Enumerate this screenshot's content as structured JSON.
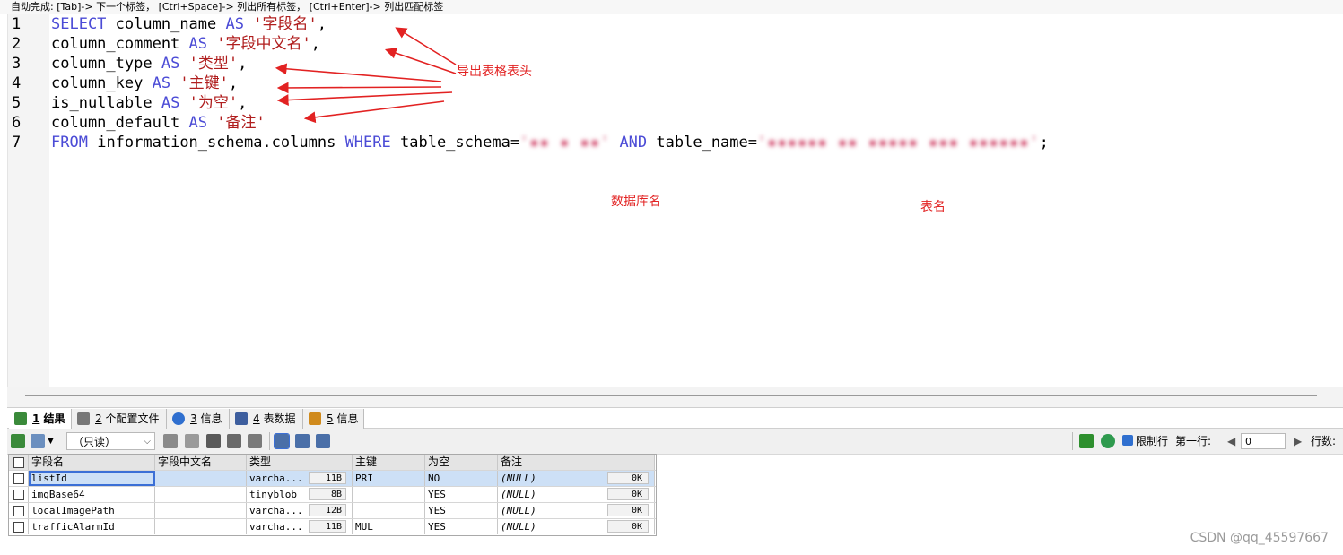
{
  "hint": "自动完成: [Tab]-> 下一个标签， [Ctrl+Space]-> 列出所有标签， [Ctrl+Enter]-> 列出匹配标签",
  "editor": {
    "line_numbers": [
      "1",
      "2",
      "3",
      "4",
      "5",
      "6",
      "7"
    ],
    "lines": [
      {
        "col": "column_name",
        "alias": "'字段名'",
        "end": ","
      },
      {
        "col": "column_comment",
        "alias": "'字段中文名'",
        "end": ","
      },
      {
        "col": "column_type",
        "alias": "'类型'",
        "end": ","
      },
      {
        "col": "column_key",
        "alias": "'主键'",
        "end": ","
      },
      {
        "col": "is_nullable",
        "alias": "'为空'",
        "end": ","
      },
      {
        "col": "column_default",
        "alias": "'备注'",
        "end": ""
      }
    ],
    "kw_select": "SELECT",
    "kw_as": "AS",
    "kw_from": "FROM",
    "kw_where": "WHERE",
    "kw_and": "AND",
    "from_table": "information_schema.columns",
    "schema_expr": "table_schema=",
    "schema_value_blurred": "'▪▪ ▪ ▪▪'",
    "name_expr": "table_name=",
    "name_value_blurred": "'▪▪▪▪▪▪ ▪▪ ▪▪▪▪▪ ▪▪▪ ▪▪▪▪▪▪'",
    "end": ";"
  },
  "annotations": {
    "export_header": "导出表格表头",
    "database_name": "数据库名",
    "table_name": "表名",
    "color": "#e22222"
  },
  "tabs": [
    {
      "num": "1",
      "label": "结果",
      "active": true,
      "icon_color": "#3a8a3a"
    },
    {
      "num": "2",
      "label": "个配置文件",
      "active": false,
      "icon_color": "#777777"
    },
    {
      "num": "3",
      "label": "信息",
      "active": false,
      "icon_color": "#2f6fcf"
    },
    {
      "num": "4",
      "label": "表数据",
      "active": false,
      "icon_color": "#3d5e9e"
    },
    {
      "num": "5",
      "label": "信息",
      "active": false,
      "icon_color": "#d08a1c"
    }
  ],
  "toolbar": {
    "mode_select": "（只读）",
    "limit_label": "限制行",
    "first_row_label": "第一行:",
    "first_row_value": "0",
    "rows_label": "行数:"
  },
  "grid": {
    "headers": [
      "字段名",
      "字段中文名",
      "类型",
      "主键",
      "为空",
      "备注"
    ],
    "rows": [
      {
        "name": "listId",
        "comment": "",
        "type": "varcha...",
        "size": "11B",
        "key": "PRI",
        "nullable": "NO",
        "default": "(NULL)",
        "default_size": "0K"
      },
      {
        "name": "imgBase64",
        "comment": "",
        "type": "tinyblob",
        "size": "8B",
        "key": "",
        "nullable": "YES",
        "default": "(NULL)",
        "default_size": "0K"
      },
      {
        "name": "localImagePath",
        "comment": "",
        "type": "varcha...",
        "size": "12B",
        "key": "",
        "nullable": "YES",
        "default": "(NULL)",
        "default_size": "0K"
      },
      {
        "name": "trafficAlarmId",
        "comment": "",
        "type": "varcha...",
        "size": "11B",
        "key": "MUL",
        "nullable": "YES",
        "default": "(NULL)",
        "default_size": "0K"
      }
    ]
  },
  "watermark": "CSDN @qq_45597667"
}
